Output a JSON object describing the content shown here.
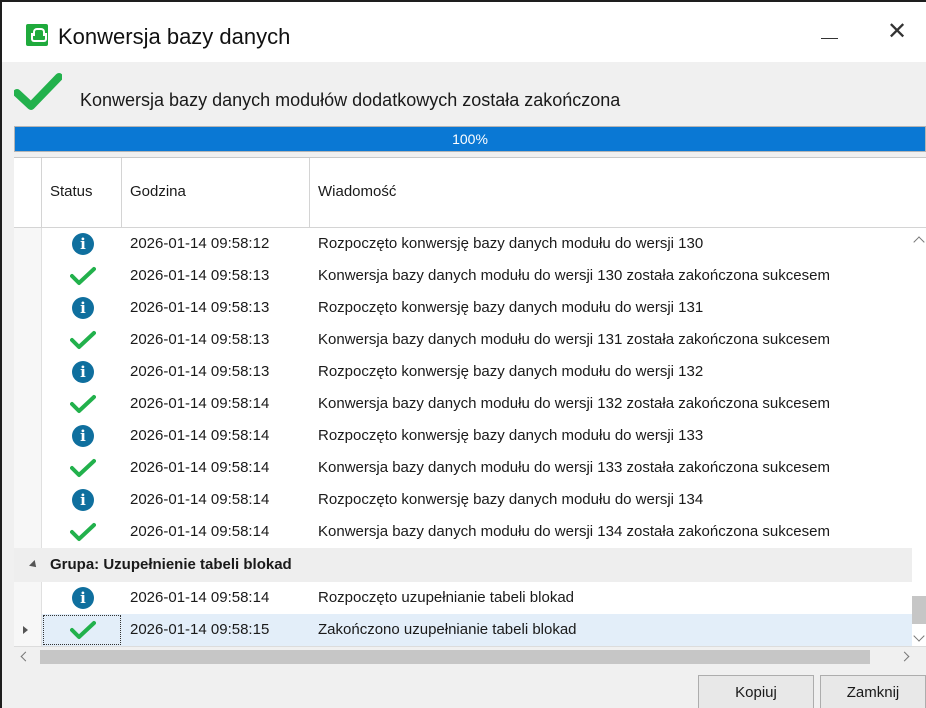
{
  "window": {
    "title": "Konwersja bazy danych",
    "close_glyph": "✕"
  },
  "status": {
    "message": "Konwersja bazy danych modułów dodatkowych została zakończona"
  },
  "progress": {
    "value_percent": 100,
    "label": "100%"
  },
  "grid": {
    "columns": [
      "Status",
      "Godzina",
      "Wiadomość"
    ],
    "rows": [
      {
        "icon": "info-icon",
        "time": "2026-01-14 09:58:12",
        "message": "Rozpoczęto konwersję bazy danych modułu do wersji 130"
      },
      {
        "icon": "check-icon",
        "time": "2026-01-14 09:58:13",
        "message": "Konwersja bazy danych modułu do wersji 130 została zakończona sukcesem"
      },
      {
        "icon": "info-icon",
        "time": "2026-01-14 09:58:13",
        "message": "Rozpoczęto konwersję bazy danych modułu do wersji 131"
      },
      {
        "icon": "check-icon",
        "time": "2026-01-14 09:58:13",
        "message": "Konwersja bazy danych modułu do wersji 131 została zakończona sukcesem"
      },
      {
        "icon": "info-icon",
        "time": "2026-01-14 09:58:13",
        "message": "Rozpoczęto konwersję bazy danych modułu do wersji 132"
      },
      {
        "icon": "check-icon",
        "time": "2026-01-14 09:58:14",
        "message": "Konwersja bazy danych modułu do wersji 132 została zakończona sukcesem"
      },
      {
        "icon": "info-icon",
        "time": "2026-01-14 09:58:14",
        "message": "Rozpoczęto konwersję bazy danych modułu do wersji 133"
      },
      {
        "icon": "check-icon",
        "time": "2026-01-14 09:58:14",
        "message": "Konwersja bazy danych modułu do wersji 133 została zakończona sukcesem"
      },
      {
        "icon": "info-icon",
        "time": "2026-01-14 09:58:14",
        "message": "Rozpoczęto konwersję bazy danych modułu do wersji 134"
      },
      {
        "icon": "check-icon",
        "time": "2026-01-14 09:58:14",
        "message": "Konwersja bazy danych modułu do wersji 134 została zakończona sukcesem"
      }
    ],
    "group": {
      "label": "Grupa: Uzupełnienie tabeli blokad",
      "rows": [
        {
          "icon": "info-icon",
          "time": "2026-01-14 09:58:14",
          "message": "Rozpoczęto uzupełnianie tabeli blokad"
        },
        {
          "icon": "check-icon",
          "time": "2026-01-14 09:58:15",
          "message": "Zakończono uzupełnianie tabeli blokad",
          "selected": true
        }
      ]
    }
  },
  "buttons": {
    "copy": "Kopiuj",
    "close": "Zamknij"
  },
  "colors": {
    "progress": "#0a78d4",
    "info": "#0f6f9e",
    "success": "#22b14c",
    "selection": "#e3eef9"
  }
}
